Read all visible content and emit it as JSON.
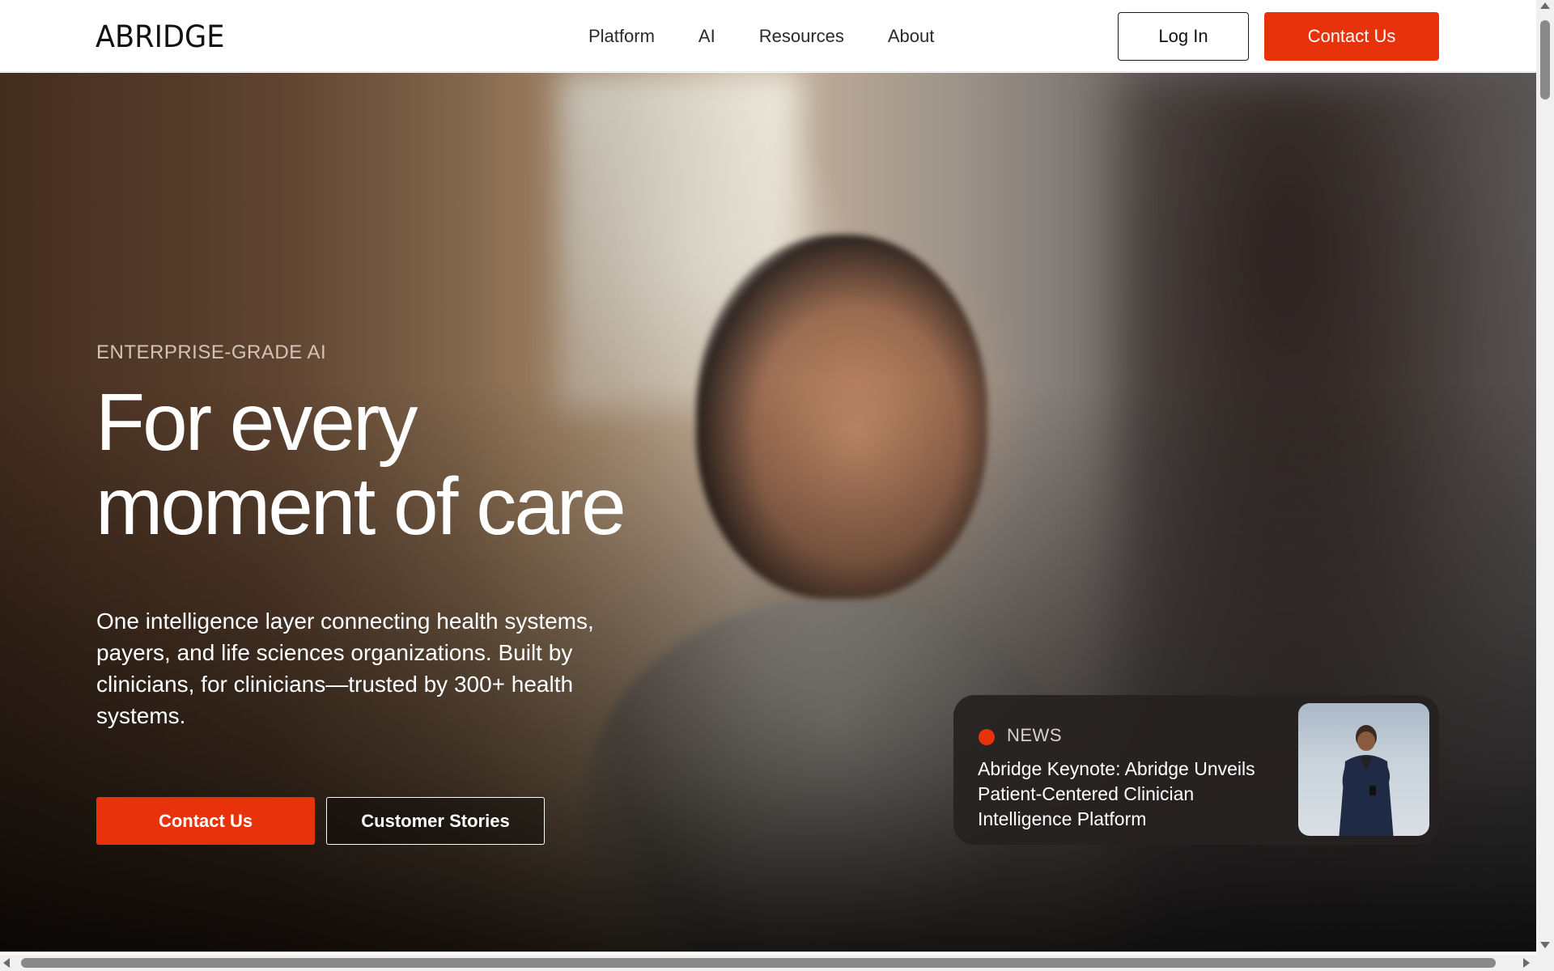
{
  "header": {
    "logo": "ABRIDGE",
    "nav": [
      {
        "label": "Platform"
      },
      {
        "label": "AI"
      },
      {
        "label": "Resources"
      },
      {
        "label": "About"
      }
    ],
    "login_label": "Log In",
    "contact_label": "Contact Us"
  },
  "hero": {
    "eyebrow": "ENTERPRISE-GRADE AI",
    "title_line1": "For every",
    "title_line2": "moment of care",
    "description": "One intelligence layer connecting health systems, payers, and life sciences organizations. Built by clinicians, for clinicians—trusted by 300+ health systems.",
    "primary_cta": "Contact Us",
    "secondary_cta": "Customer Stories"
  },
  "news": {
    "tag": "NEWS",
    "headline": "Abridge Keynote: Abridge Unveils Patient-Centered Clinician Intelligence Platform"
  },
  "colors": {
    "accent": "#e8320c",
    "header_bg": "#ffffff",
    "text_dark": "#111111",
    "news_card_bg": "#262221"
  },
  "icons": {
    "news_indicator": "red-dot-icon",
    "scroll_up": "chevron-up-icon",
    "scroll_down": "chevron-down-icon",
    "scroll_left": "chevron-left-icon",
    "scroll_right": "chevron-right-icon"
  }
}
